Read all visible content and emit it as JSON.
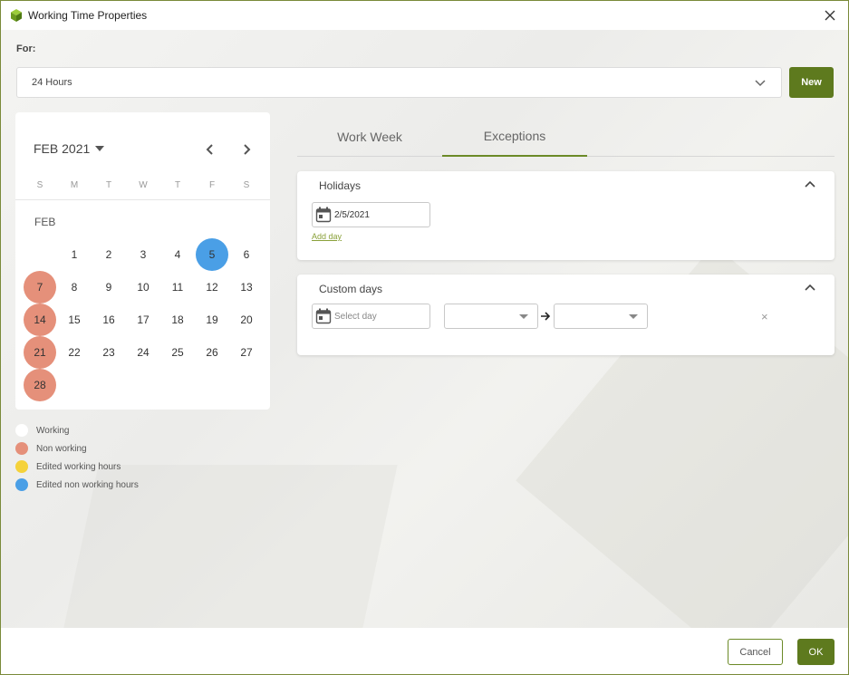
{
  "window": {
    "title": "Working Time Properties"
  },
  "for_field": {
    "label": "For:",
    "value": "24 Hours",
    "new_label": "New"
  },
  "calendar": {
    "month_title": "FEB 2021",
    "weekdays": [
      "S",
      "M",
      "T",
      "W",
      "T",
      "F",
      "S"
    ],
    "month_sub": "FEB",
    "days": [
      "1",
      "2",
      "3",
      "4",
      "5",
      "6",
      "7",
      "8",
      "9",
      "10",
      "11",
      "12",
      "13",
      "14",
      "15",
      "16",
      "17",
      "18",
      "19",
      "20",
      "21",
      "22",
      "23",
      "24",
      "25",
      "26",
      "27",
      "28"
    ]
  },
  "legend": [
    {
      "label": "Working",
      "color": "#ffffff"
    },
    {
      "label": "Non working",
      "color": "#e5907a"
    },
    {
      "label": "Edited working hours",
      "color": "#f5d23a"
    },
    {
      "label": "Edited non working hours",
      "color": "#4a9fe6"
    }
  ],
  "tabs": [
    {
      "label": "Work Week",
      "active": false
    },
    {
      "label": "Exceptions",
      "active": true
    }
  ],
  "holidays": {
    "title": "Holidays",
    "date_value": "2/5/2021",
    "add_day": "Add day"
  },
  "custom_days": {
    "title": "Custom days",
    "placeholder": "Select day",
    "remove": "×"
  },
  "footer": {
    "cancel": "Cancel",
    "ok": "OK"
  },
  "colors": {
    "accent": "#5e7a1e",
    "non_working": "#e5907a",
    "edited_non_working": "#4a9fe6",
    "edited_working": "#f5d23a"
  }
}
